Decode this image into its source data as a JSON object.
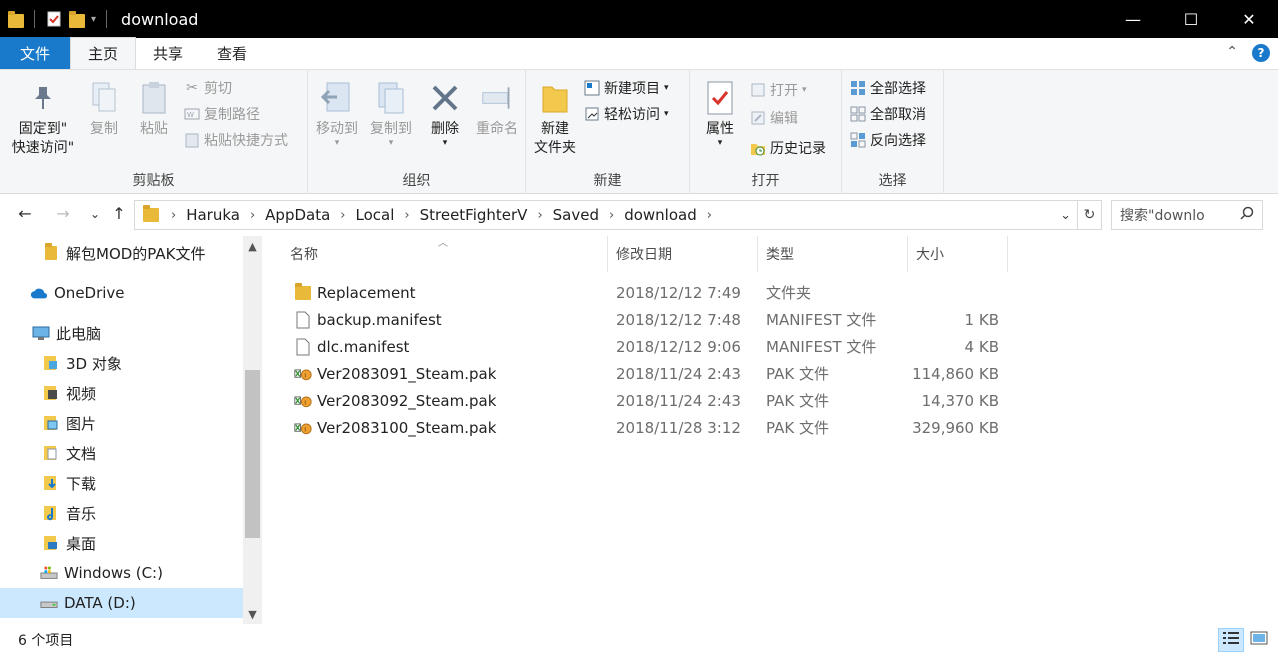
{
  "window": {
    "title": "download",
    "minimize_glyph": "—",
    "maximize_glyph": "☐",
    "close_glyph": "✕"
  },
  "ribbon_tabs": [
    "文件",
    "主页",
    "共享",
    "查看"
  ],
  "clipboard": {
    "label": "剪贴板",
    "pin_label_1": "固定到\"",
    "pin_label_2": "快速访问\"",
    "copy": "复制",
    "paste": "粘贴",
    "cut": "剪切",
    "copy_path": "复制路径",
    "paste_shortcut": "粘贴快捷方式"
  },
  "organize": {
    "label": "组织",
    "move_to": "移动到",
    "copy_to": "复制到",
    "delete": "删除",
    "rename": "重命名"
  },
  "new_group": {
    "label": "新建",
    "new_folder_1": "新建",
    "new_folder_2": "文件夹",
    "new_item": "新建项目",
    "easy_access": "轻松访问"
  },
  "open_group": {
    "label": "打开",
    "properties": "属性",
    "open": "打开",
    "edit": "编辑",
    "history": "历史记录"
  },
  "select_group": {
    "label": "选择",
    "select_all": "全部选择",
    "select_none": "全部取消",
    "invert": "反向选择"
  },
  "breadcrumbs": [
    "Haruka",
    "AppData",
    "Local",
    "StreetFighterV",
    "Saved",
    "download"
  ],
  "search": {
    "placeholder": "搜索\"downlo"
  },
  "nav_items": [
    {
      "label": "解包MOD的PAK文件",
      "icon": "folder-icon"
    },
    {
      "label": "OneDrive",
      "icon": "cloud-icon"
    },
    {
      "label": "此电脑",
      "icon": "computer-icon"
    },
    {
      "label": "3D 对象",
      "icon": "3d-objects-icon"
    },
    {
      "label": "视频",
      "icon": "video-icon"
    },
    {
      "label": "图片",
      "icon": "pictures-icon"
    },
    {
      "label": "文档",
      "icon": "documents-icon"
    },
    {
      "label": "下载",
      "icon": "download-icon"
    },
    {
      "label": "音乐",
      "icon": "music-icon"
    },
    {
      "label": "桌面",
      "icon": "desktop-icon"
    },
    {
      "label": "Windows (C:)",
      "icon": "drive-c-icon"
    },
    {
      "label": "DATA (D:)",
      "icon": "drive-d-icon"
    }
  ],
  "columns": {
    "name": "名称",
    "date": "修改日期",
    "type": "类型",
    "size": "大小"
  },
  "files": [
    {
      "name": "Replacement",
      "date": "2018/12/12 7:49",
      "type": "文件夹",
      "size": "",
      "icon": "folder-icon"
    },
    {
      "name": "backup.manifest",
      "date": "2018/12/12 7:48",
      "type": "MANIFEST 文件",
      "size": "1 KB",
      "icon": "file-icon"
    },
    {
      "name": "dlc.manifest",
      "date": "2018/12/12 9:06",
      "type": "MANIFEST 文件",
      "size": "4 KB",
      "icon": "file-icon"
    },
    {
      "name": "Ver2083091_Steam.pak",
      "date": "2018/11/24 2:43",
      "type": "PAK 文件",
      "size": "114,860 KB",
      "icon": "pak-icon"
    },
    {
      "name": "Ver2083092_Steam.pak",
      "date": "2018/11/24 2:43",
      "type": "PAK 文件",
      "size": "14,370 KB",
      "icon": "pak-icon"
    },
    {
      "name": "Ver2083100_Steam.pak",
      "date": "2018/11/28 3:12",
      "type": "PAK 文件",
      "size": "329,960 KB",
      "icon": "pak-icon"
    }
  ],
  "status": {
    "item_count": "6 个项目"
  },
  "colors": {
    "accent": "#1979ca",
    "titlebar": "#000000",
    "selected": "#cce8ff"
  }
}
